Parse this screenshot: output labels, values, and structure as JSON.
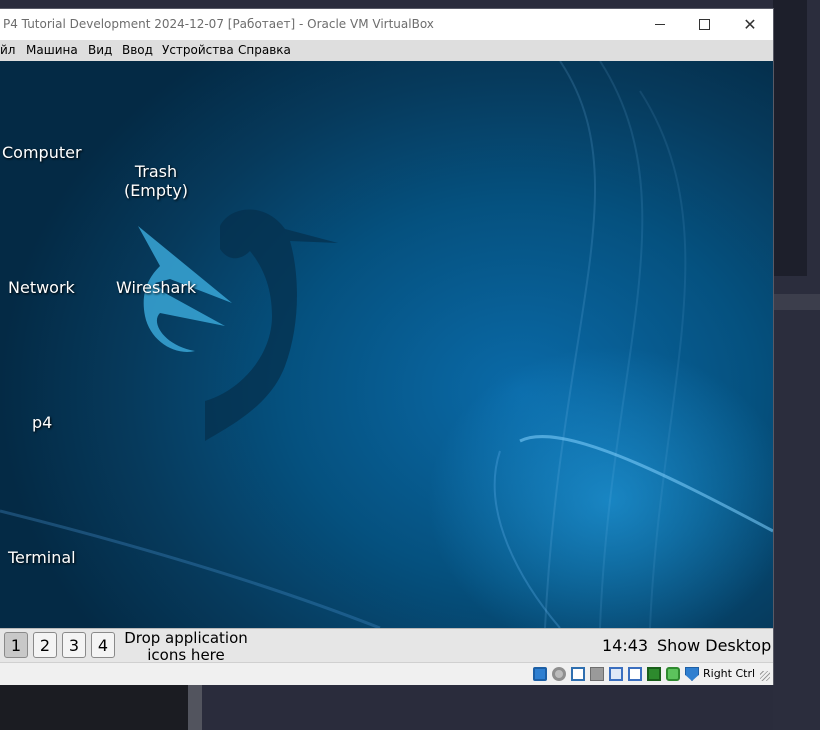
{
  "window": {
    "title": "P4 Tutorial Development 2024-12-07 [Работает] - Oracle VM VirtualBox",
    "minimize": "minimize",
    "maximize": "maximize",
    "close": "✕"
  },
  "menu": {
    "items": [
      "йл",
      "Машина",
      "Вид",
      "Ввод",
      "Устройства",
      "Справка"
    ]
  },
  "desktop": {
    "icons": [
      {
        "label": "Computer"
      },
      {
        "label": "Trash\n(Empty)"
      },
      {
        "label": "Network"
      },
      {
        "label": "Wireshark"
      },
      {
        "label": "p4"
      },
      {
        "label": "Terminal"
      }
    ]
  },
  "taskbar": {
    "workspaces": [
      "1",
      "2",
      "3",
      "4"
    ],
    "active_workspace": "1",
    "drop_text": "Drop application icons here",
    "clock": "14:43",
    "show_desktop": "Show Desktop"
  },
  "statusbar": {
    "icons": [
      "hard-disk-icon",
      "optical-drive-icon",
      "network-icon",
      "usb-icon",
      "shared-folders-icon",
      "display-icon",
      "video-capture-icon",
      "cpu-icon",
      "mouse-integration-icon",
      "keyboard-icon"
    ],
    "host_key": "Right Ctrl"
  },
  "colors": {
    "desktop_bg": "#05517f",
    "taskbar_bg": "#e6e6e6",
    "menubar_bg": "#dedede"
  }
}
